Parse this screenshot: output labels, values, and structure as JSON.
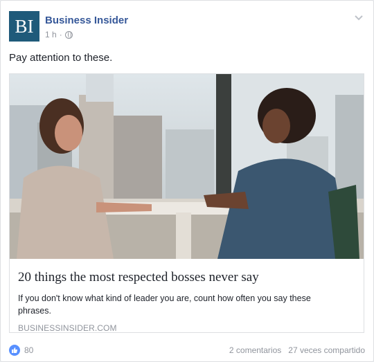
{
  "post": {
    "page_name": "Business Insider",
    "avatar_text": "BI",
    "time": "1 h",
    "separator": "·",
    "audience_icon": "globe-icon",
    "menu_icon": "chevron-down-icon",
    "text": "Pay attention to these."
  },
  "link": {
    "title": "20 things the most respected bosses never say",
    "description": "If you don't know what kind of leader you are, count how often you say these phrases.",
    "domain": "BUSINESSINSIDER.COM"
  },
  "footer": {
    "reaction_icon": "like-icon",
    "reaction_count": "80",
    "comments": "2 comentarios",
    "shares": "27 veces compartido"
  },
  "colors": {
    "brand_avatar": "#1f5a7a",
    "link_blue": "#365899",
    "muted": "#90949c",
    "like_blue": "#5890ff"
  }
}
